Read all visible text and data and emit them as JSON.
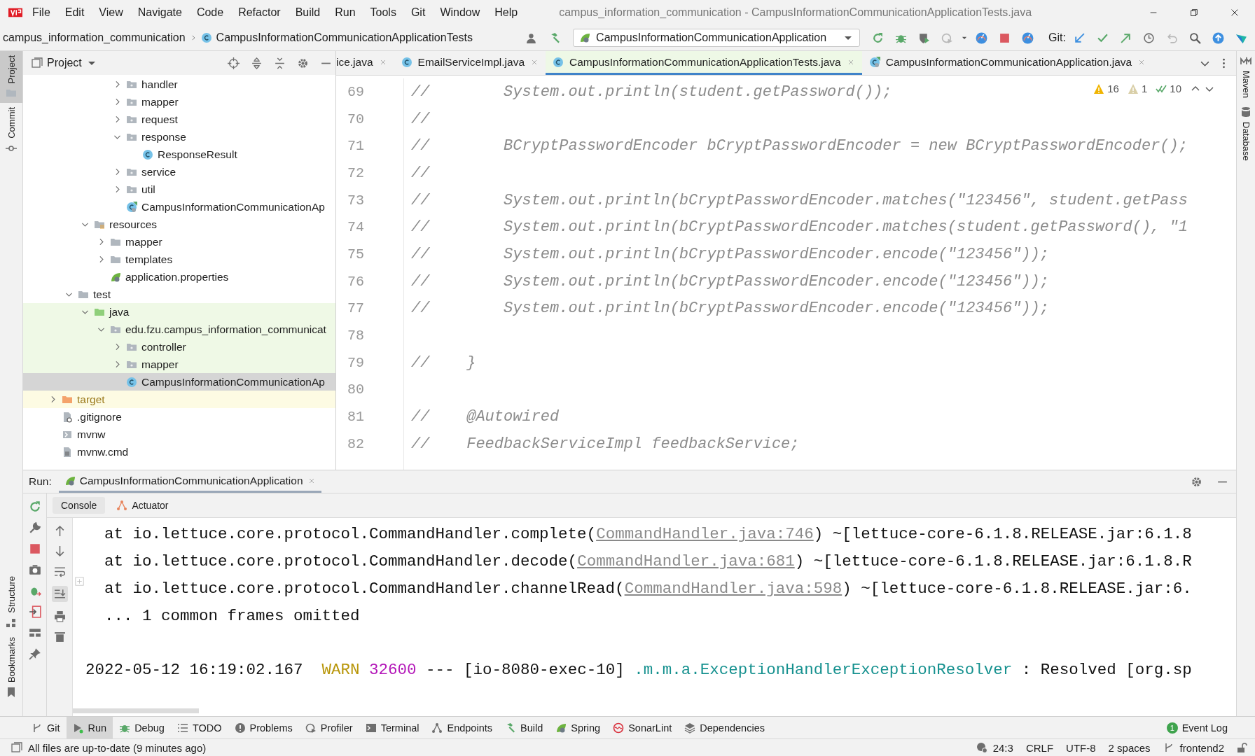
{
  "window": {
    "title": "campus_information_communication - CampusInformationCommunicationApplicationTests.java"
  },
  "menu": [
    "File",
    "Edit",
    "View",
    "Navigate",
    "Code",
    "Refactor",
    "Build",
    "Run",
    "Tools",
    "Git",
    "Window",
    "Help"
  ],
  "breadcrumbs": [
    "campus_information_communication",
    "CampusInformationCommunicationApplicationTests"
  ],
  "run_config": "CampusInformationCommunicationApplication",
  "git_label": "Git:",
  "left_stripe": {
    "top": [
      {
        "label": "Project",
        "selected": true
      },
      {
        "label": "Commit",
        "selected": false
      }
    ],
    "bottom": [
      {
        "label": "Structure",
        "selected": false
      },
      {
        "label": "Bookmarks",
        "selected": false
      }
    ]
  },
  "right_stripe": [
    {
      "label": "Maven",
      "selected": false
    },
    {
      "label": "Database",
      "selected": false
    }
  ],
  "project_panel": {
    "title": "Project"
  },
  "tree": [
    {
      "children": [
        {
          "children": [
            {
              "children": [
                {
                  "children": [
                    {
                      "label": "handler",
                      "kind": "package",
                      "expanded": false,
                      "selected": false
                    },
                    {
                      "label": "mapper",
                      "kind": "package",
                      "expanded": false,
                      "selected": false
                    },
                    {
                      "label": "request",
                      "kind": "package",
                      "expanded": false,
                      "selected": false
                    },
                    {
                      "label": "response",
                      "kind": "package",
                      "expanded": true,
                      "selected": false,
                      "children": [
                        {
                          "label": "ResponseResult",
                          "kind": "class",
                          "selected": false
                        }
                      ]
                    },
                    {
                      "label": "service",
                      "kind": "package",
                      "expanded": false,
                      "selected": false
                    },
                    {
                      "label": "util",
                      "kind": "package",
                      "expanded": false,
                      "selected": false
                    },
                    {
                      "label": "CampusInformationCommunicationAp",
                      "kind": "spring-class",
                      "selected": false
                    }
                  ]
                }
              ]
            },
            {
              "label": "resources",
              "kind": "resources",
              "expanded": true,
              "selected": false,
              "children": [
                {
                  "label": "mapper",
                  "kind": "folder",
                  "expanded": false,
                  "selected": false
                },
                {
                  "label": "templates",
                  "kind": "folder",
                  "expanded": false,
                  "selected": false
                },
                {
                  "label": "application.properties",
                  "kind": "properties",
                  "selected": false
                }
              ]
            }
          ]
        },
        {
          "label": "test",
          "kind": "folder",
          "expanded": true,
          "selected": false,
          "children": [
            {
              "label": "java",
              "kind": "test-root",
              "test_scope": true,
              "expanded": true,
              "selected": false,
              "children": [
                {
                  "label": "edu.fzu.campus_information_communicat",
                  "kind": "package",
                  "test_scope": true,
                  "expanded": true,
                  "selected": false,
                  "children": [
                    {
                      "label": "controller",
                      "kind": "package",
                      "test_scope": true,
                      "expanded": false,
                      "selected": false
                    },
                    {
                      "label": "mapper",
                      "kind": "package",
                      "test_scope": true,
                      "expanded": false,
                      "selected": false
                    },
                    {
                      "label": "CampusInformationCommunicationAp",
                      "kind": "class",
                      "selected": true
                    }
                  ]
                }
              ]
            }
          ]
        }
      ]
    },
    {
      "label": "target",
      "kind": "excluded",
      "excluded": true,
      "expanded": false,
      "selected": false
    },
    {
      "label": ".gitignore",
      "kind": "ignore-file",
      "selected": false
    },
    {
      "label": "mvnw",
      "kind": "script-file",
      "selected": false
    },
    {
      "label": "mvnw.cmd",
      "kind": "text-file",
      "selected": false
    }
  ],
  "editor_tabs": [
    {
      "label": "ice.java",
      "kind": "plain",
      "selected": false
    },
    {
      "label": "EmailServiceImpl.java",
      "kind": "class",
      "selected": false
    },
    {
      "label": "CampusInformationCommunicationApplicationTests.java",
      "kind": "class",
      "selected": true
    },
    {
      "label": "CampusInformationCommunicationApplication.java",
      "kind": "spring-class",
      "selected": false
    }
  ],
  "inspections": {
    "warnings": "16",
    "weak_warnings": "1",
    "typos": "10"
  },
  "code": [
    {
      "number": "69",
      "text": "//        System.out.println(student.getPassword());"
    },
    {
      "number": "70",
      "text": "//"
    },
    {
      "number": "71",
      "text": "//        BCryptPasswordEncoder bCryptPasswordEncoder = new BCryptPasswordEncoder();"
    },
    {
      "number": "72",
      "text": "//"
    },
    {
      "number": "73",
      "text": "//        System.out.println(bCryptPasswordEncoder.matches(\"123456\", student.getPass"
    },
    {
      "number": "74",
      "text": "//        System.out.println(bCryptPasswordEncoder.matches(student.getPassword(), \"1"
    },
    {
      "number": "75",
      "text": "//        System.out.println(bCryptPasswordEncoder.encode(\"123456\"));"
    },
    {
      "number": "76",
      "text": "//        System.out.println(bCryptPasswordEncoder.encode(\"123456\"));"
    },
    {
      "number": "77",
      "text": "//        System.out.println(bCryptPasswordEncoder.encode(\"123456\"));"
    },
    {
      "number": "78"
    },
    {
      "number": "79",
      "text": "//    }"
    },
    {
      "number": "80"
    },
    {
      "number": "81",
      "text": "//    @Autowired"
    },
    {
      "number": "82",
      "text": "//    FeedbackServiceImpl feedbackService;"
    }
  ],
  "run_panel": {
    "label": "Run:",
    "tab": "CampusInformationCommunicationApplication",
    "subtabs": [
      {
        "label": "Console",
        "selected": true
      },
      {
        "label": "Actuator",
        "selected": false
      }
    ]
  },
  "console": [
    {
      "kind": "trace",
      "segments": [
        {
          "kind": "plain",
          "text": "  at io.lettuce.core.protocol.CommandHandler.complete("
        },
        {
          "kind": "link",
          "text": "CommandHandler.java:746"
        },
        {
          "kind": "plain",
          "text": ") ~[lettuce-core-6.1.8.RELEASE.jar:6.1.8"
        }
      ]
    },
    {
      "kind": "trace",
      "segments": [
        {
          "kind": "plain",
          "text": "  at io.lettuce.core.protocol.CommandHandler.decode("
        },
        {
          "kind": "link",
          "text": "CommandHandler.java:681"
        },
        {
          "kind": "plain",
          "text": ") ~[lettuce-core-6.1.8.RELEASE.jar:6.1.8.R"
        }
      ]
    },
    {
      "kind": "trace",
      "segments": [
        {
          "kind": "plain",
          "text": "  at io.lettuce.core.protocol.CommandHandler.channelRead("
        },
        {
          "kind": "link",
          "text": "CommandHandler.java:598"
        },
        {
          "kind": "plain",
          "text": ") ~[lettuce-core-6.1.8.RELEASE.jar:6."
        }
      ]
    },
    {
      "kind": "trace",
      "segments": [
        {
          "kind": "plain",
          "text": "  ... 1 common frames omitted"
        }
      ]
    },
    {
      "kind": "log",
      "segments": [
        {
          "kind": "plain",
          "text": "2022-05-12 16:19:02.167  "
        },
        {
          "kind": "warn",
          "text": "WARN"
        },
        {
          "kind": "pid",
          "text": "32600"
        },
        {
          "kind": "plain",
          "text": " --- [io-8080-exec-10] "
        },
        {
          "kind": "logger",
          "text": ".m.m.a.ExceptionHandlerExceptionResolver"
        },
        {
          "kind": "plain",
          "text": " : Resolved [org.sp"
        }
      ]
    }
  ],
  "tool_windows": [
    {
      "label": "Git",
      "selected": false
    },
    {
      "label": "Run",
      "selected": true
    },
    {
      "label": "Debug",
      "selected": false
    },
    {
      "label": "TODO",
      "selected": false
    },
    {
      "label": "Problems",
      "selected": false
    },
    {
      "label": "Profiler",
      "selected": false
    },
    {
      "label": "Terminal",
      "selected": false
    },
    {
      "label": "Endpoints",
      "selected": false
    },
    {
      "label": "Build",
      "selected": false
    },
    {
      "label": "Spring",
      "selected": false
    },
    {
      "label": "SonarLint",
      "selected": false
    },
    {
      "label": "Dependencies",
      "selected": false
    }
  ],
  "event_log": {
    "label": "Event Log",
    "count": "1"
  },
  "status_bar": {
    "message": "All files are up-to-date (9 minutes ago)",
    "position": "24:3",
    "line_separator": "CRLF",
    "encoding": "UTF-8",
    "indent": "2 spaces",
    "branch": "frontend2"
  }
}
